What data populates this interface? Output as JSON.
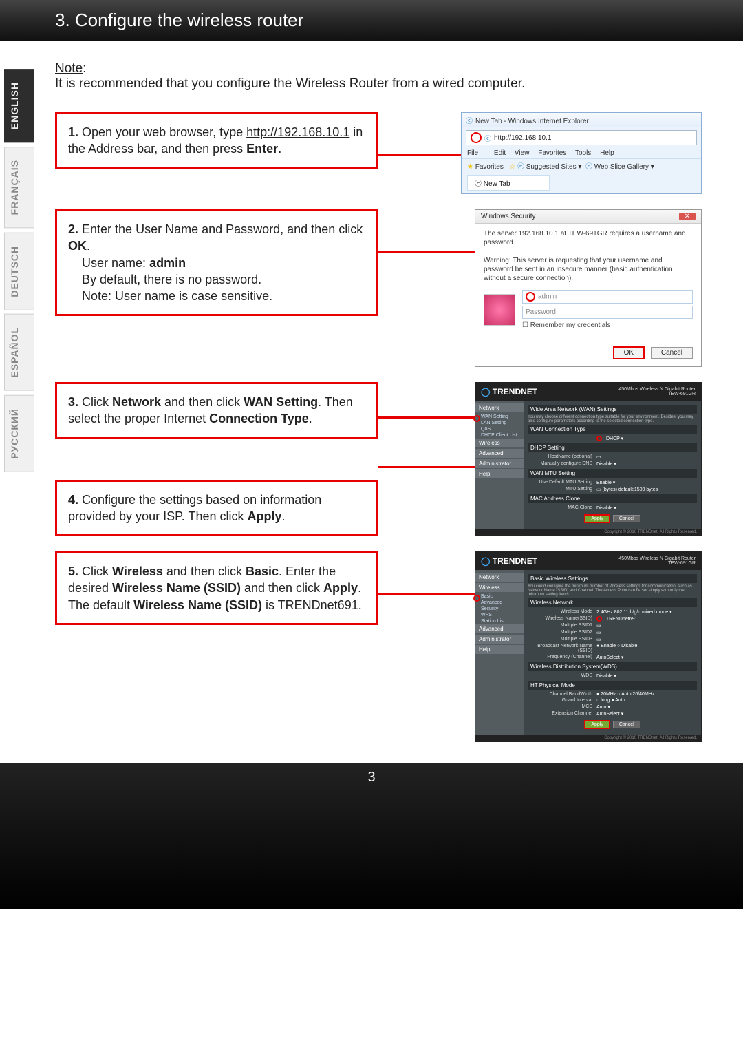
{
  "header": {
    "title": "3. Configure the wireless router"
  },
  "languages": {
    "english": "ENGLISH",
    "francais": "FRANÇAIS",
    "deutsch": "DEUTSCH",
    "espanol": "ESPAÑOL",
    "russian": "РУССКИЙ"
  },
  "note": {
    "label": "Note",
    "text": "It is recommended that you configure the Wireless Router from a wired computer."
  },
  "steps": {
    "s1_num": "1.",
    "s1_a": " Open your web browser, type ",
    "s1_url": "http://192.168.10.1",
    "s1_b": " in the Address bar, and then press ",
    "s1_enter": "Enter",
    "s1_c": ".",
    "s2_num": "2.",
    "s2_a": " Enter the User Name and Password, and then click ",
    "s2_ok": "OK",
    "s2_b": ".",
    "s2_user_label": "User name: ",
    "s2_user": "admin",
    "s2_default": "By default, there is no password.",
    "s2_note": "Note: User name is case sensitive.",
    "s3_num": "3.",
    "s3_a": " Click ",
    "s3_net": "Network",
    "s3_b": " and then click ",
    "s3_wan": "WAN Setting",
    "s3_c": ". Then select the proper Internet ",
    "s3_conn": "Connection Type",
    "s3_d": ".",
    "s4_num": "4.",
    "s4_a": " Configure the settings based on information provided by your ISP. Then click ",
    "s4_apply": "Apply",
    "s4_b": ".",
    "s5_num": "5.",
    "s5_a": " Click ",
    "s5_wl": "Wireless",
    "s5_b": " and then click ",
    "s5_basic": "Basic",
    "s5_c": ". Enter the desired ",
    "s5_ssid": "Wireless Name (SSID)",
    "s5_d": " and then click ",
    "s5_apply": "Apply",
    "s5_e": ". The default ",
    "s5_ssid2": "Wireless Name (SSID)",
    "s5_f": " is TRENDnet691."
  },
  "ie": {
    "title": "New Tab - Windows Internet Explorer",
    "url": "http://192.168.10.1",
    "menu_file": "File",
    "menu_edit": "Edit",
    "menu_view": "View",
    "menu_fav": "Favorites",
    "menu_tools": "Tools",
    "menu_help": "Help",
    "fav_label": "Favorites",
    "suggested": "Suggested Sites",
    "webslice": "Web Slice Gallery",
    "tab": "New Tab"
  },
  "security": {
    "title": "Windows Security",
    "line1": "The server 192.168.10.1 at TEW-691GR requires a username and password.",
    "warn": "Warning: This server is requesting that your username and password be sent in an insecure manner (basic authentication without a secure connection).",
    "user_ph": "admin",
    "pass_ph": "Password",
    "remember": "Remember my credentials",
    "ok": "OK",
    "cancel": "Cancel"
  },
  "router1": {
    "brand": "TRENDNET",
    "model_a": "450Mbps Wireless N Gigabit Router",
    "model_b": "TEW-691GR",
    "nav_network": "Network",
    "nav_wan": "WAN Setting",
    "nav_lan": "LAN Setting",
    "nav_qos": "QoS",
    "nav_dhcp": "DHCP Client List",
    "nav_wireless": "Wireless",
    "nav_advanced": "Advanced",
    "nav_admin": "Administrator",
    "nav_help": "Help",
    "title": "Wide Area Network (WAN) Settings",
    "desc": "You may choose different connection type suitable for your environment. Besides, you may also configure parameters according to the selected connection type.",
    "wct": "WAN Connection Type",
    "wct_v": "DHCP",
    "dhcp": "DHCP Setting",
    "hostname": "HostName (optional)",
    "mancfg": "Manually configure DNS",
    "mancfg_v": "Disable",
    "mtu": "WAN MTU Setting",
    "usedef": "Use Default MTU Setting",
    "usedef_v": "Enable",
    "mtusz": "MTU Setting",
    "mtusz_v": "(bytes) default:1500 bytes",
    "mac": "MAC Address Clone",
    "macc": "MAC Clone",
    "macc_v": "Disable",
    "apply": "Apply",
    "cancel": "Cancel",
    "footer": "Copyright © 2010 TRENDnet. All Rights Reserved."
  },
  "router2": {
    "brand": "TRENDNET",
    "model_a": "450Mbps Wireless N Gigabit Router",
    "model_b": "TEW-691GR",
    "nav_network": "Network",
    "nav_wireless": "Wireless",
    "nav_basic": "Basic",
    "nav_adv": "Advanced",
    "nav_sec": "Security",
    "nav_wps": "WPS",
    "nav_stn": "Station List",
    "nav_advanced": "Advanced",
    "nav_admin": "Administrator",
    "nav_help": "Help",
    "title": "Basic Wireless Settings",
    "desc": "You could configure the minimum number of Wireless settings for communication, such as Network Name (SSID) and Channel. The Access Point can be set simply with only the minimum setting items.",
    "wn": "Wireless Network",
    "wmode": "Wireless Mode",
    "wmode_v": "2.4GHz 802.11 b/g/n mixed mode",
    "wname": "Wireless Name(SSID)",
    "wname_v": "TRENDnet691",
    "mssid1": "Multiple SSID1",
    "mssid2": "Multiple SSID2",
    "mssid3": "Multiple SSID3",
    "bns": "Broadcast Network Name (SSID)",
    "bns_v": "● Enable  ○ Disable",
    "freq": "Frequency (Channel)",
    "freq_v": "AutoSelect",
    "wds": "Wireless Distribution System(WDS)",
    "wdsl": "WDS",
    "wdsv": "Disable",
    "phy": "HT Physical Mode",
    "cb": "Channel BandWidth",
    "cb_v": "● 20MHz  ○ Auto 20/40MHz",
    "gi": "Guard Interval",
    "gi_v": "○ long  ● Auto",
    "mcs": "MCS",
    "mcs_v": "Auto",
    "ec": "Extension Channel",
    "ec_v": "AutoSelect",
    "apply": "Apply",
    "cancel": "Cancel",
    "footer": "Copyright © 2010 TRENDnet. All Rights Reserved."
  },
  "page_number": "3"
}
